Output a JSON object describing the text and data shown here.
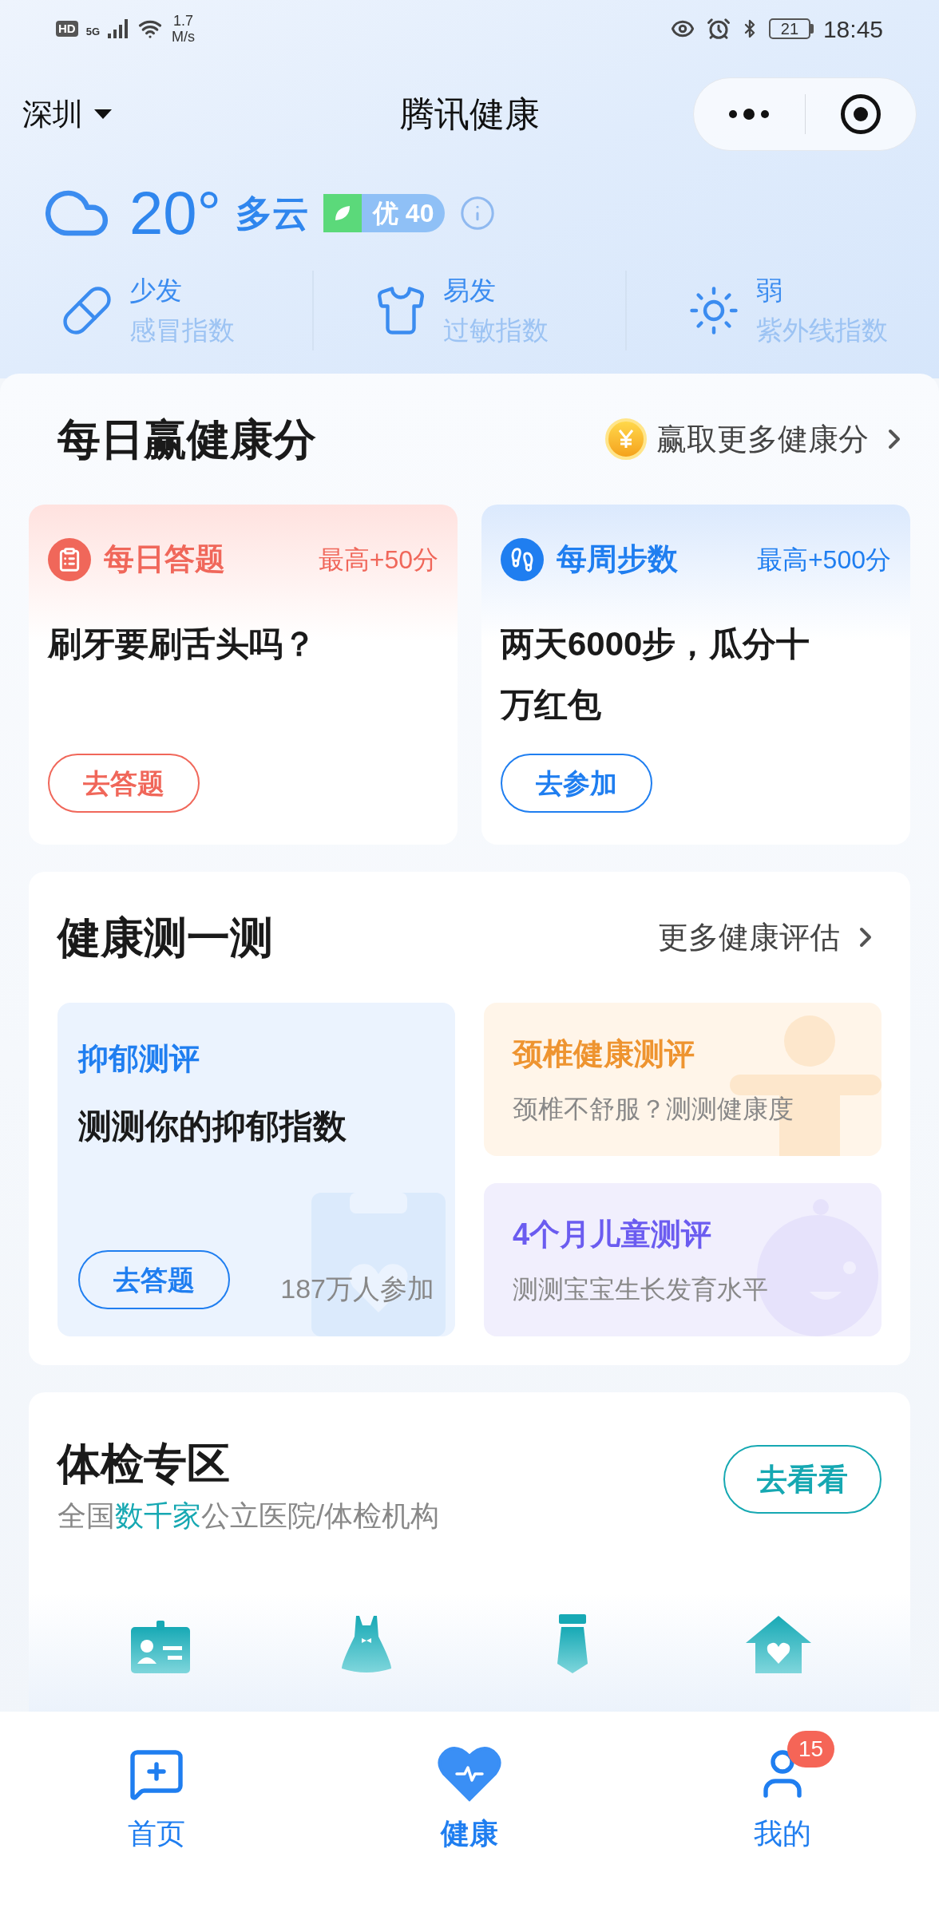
{
  "status_bar": {
    "hd": "HD",
    "network": "5G",
    "speed": "1.7",
    "speed_unit": "M/s",
    "battery": "21",
    "time": "18:45"
  },
  "header": {
    "city": "深圳",
    "title": "腾讯健康"
  },
  "weather": {
    "temperature": "20°",
    "condition": "多云",
    "air_quality": "优 40"
  },
  "indices": [
    {
      "kind": "cold",
      "level": "少发",
      "name": "感冒指数"
    },
    {
      "kind": "allergy",
      "level": "易发",
      "name": "过敏指数"
    },
    {
      "kind": "uv",
      "level": "弱",
      "name": "紫外线指数"
    }
  ],
  "daily_points": {
    "title": "每日赢健康分",
    "link": "赢取更多健康分",
    "tasks": [
      {
        "kind": "quiz",
        "title": "每日答题",
        "bonus": "最高+50分",
        "text": "刷牙要刷舌头吗？",
        "button": "去答题",
        "color": "#f0675a"
      },
      {
        "kind": "steps",
        "title": "每周步数",
        "bonus": "最高+500分",
        "text": "两天6000步，瓜分十万红包",
        "button": "去参加",
        "color": "#1f7ef0"
      }
    ]
  },
  "health_tests": {
    "title": "健康测一测",
    "link": "更多健康评估",
    "featured": {
      "title": "抑郁测评",
      "description": "测测你的抑郁指数",
      "button": "去答题",
      "participants": "187万人参加"
    },
    "tests": [
      {
        "kind": "neck",
        "title": "颈椎健康测评",
        "description": "颈椎不舒服？测测健康度",
        "color": "#ee9430"
      },
      {
        "kind": "child",
        "title": "4个月儿童测评",
        "description": "测测宝宝生长发育水平",
        "color": "#6b5cf0"
      }
    ]
  },
  "checkup": {
    "title": "体检专区",
    "subtitle": [
      {
        "text": "全国",
        "highlight": false
      },
      {
        "text": "数千家",
        "highlight": true
      },
      {
        "text": "公立医院/体检机构",
        "highlight": false
      }
    ],
    "button": "去看看",
    "categories": [
      {
        "kind": "badge"
      },
      {
        "kind": "dress"
      },
      {
        "kind": "tie"
      },
      {
        "kind": "house"
      }
    ]
  },
  "tab_bar": [
    {
      "kind": "home",
      "label": "首页",
      "selected": false
    },
    {
      "kind": "health",
      "label": "健康",
      "selected": true
    },
    {
      "kind": "me",
      "label": "我的",
      "selected": false,
      "badge": "15"
    }
  ]
}
